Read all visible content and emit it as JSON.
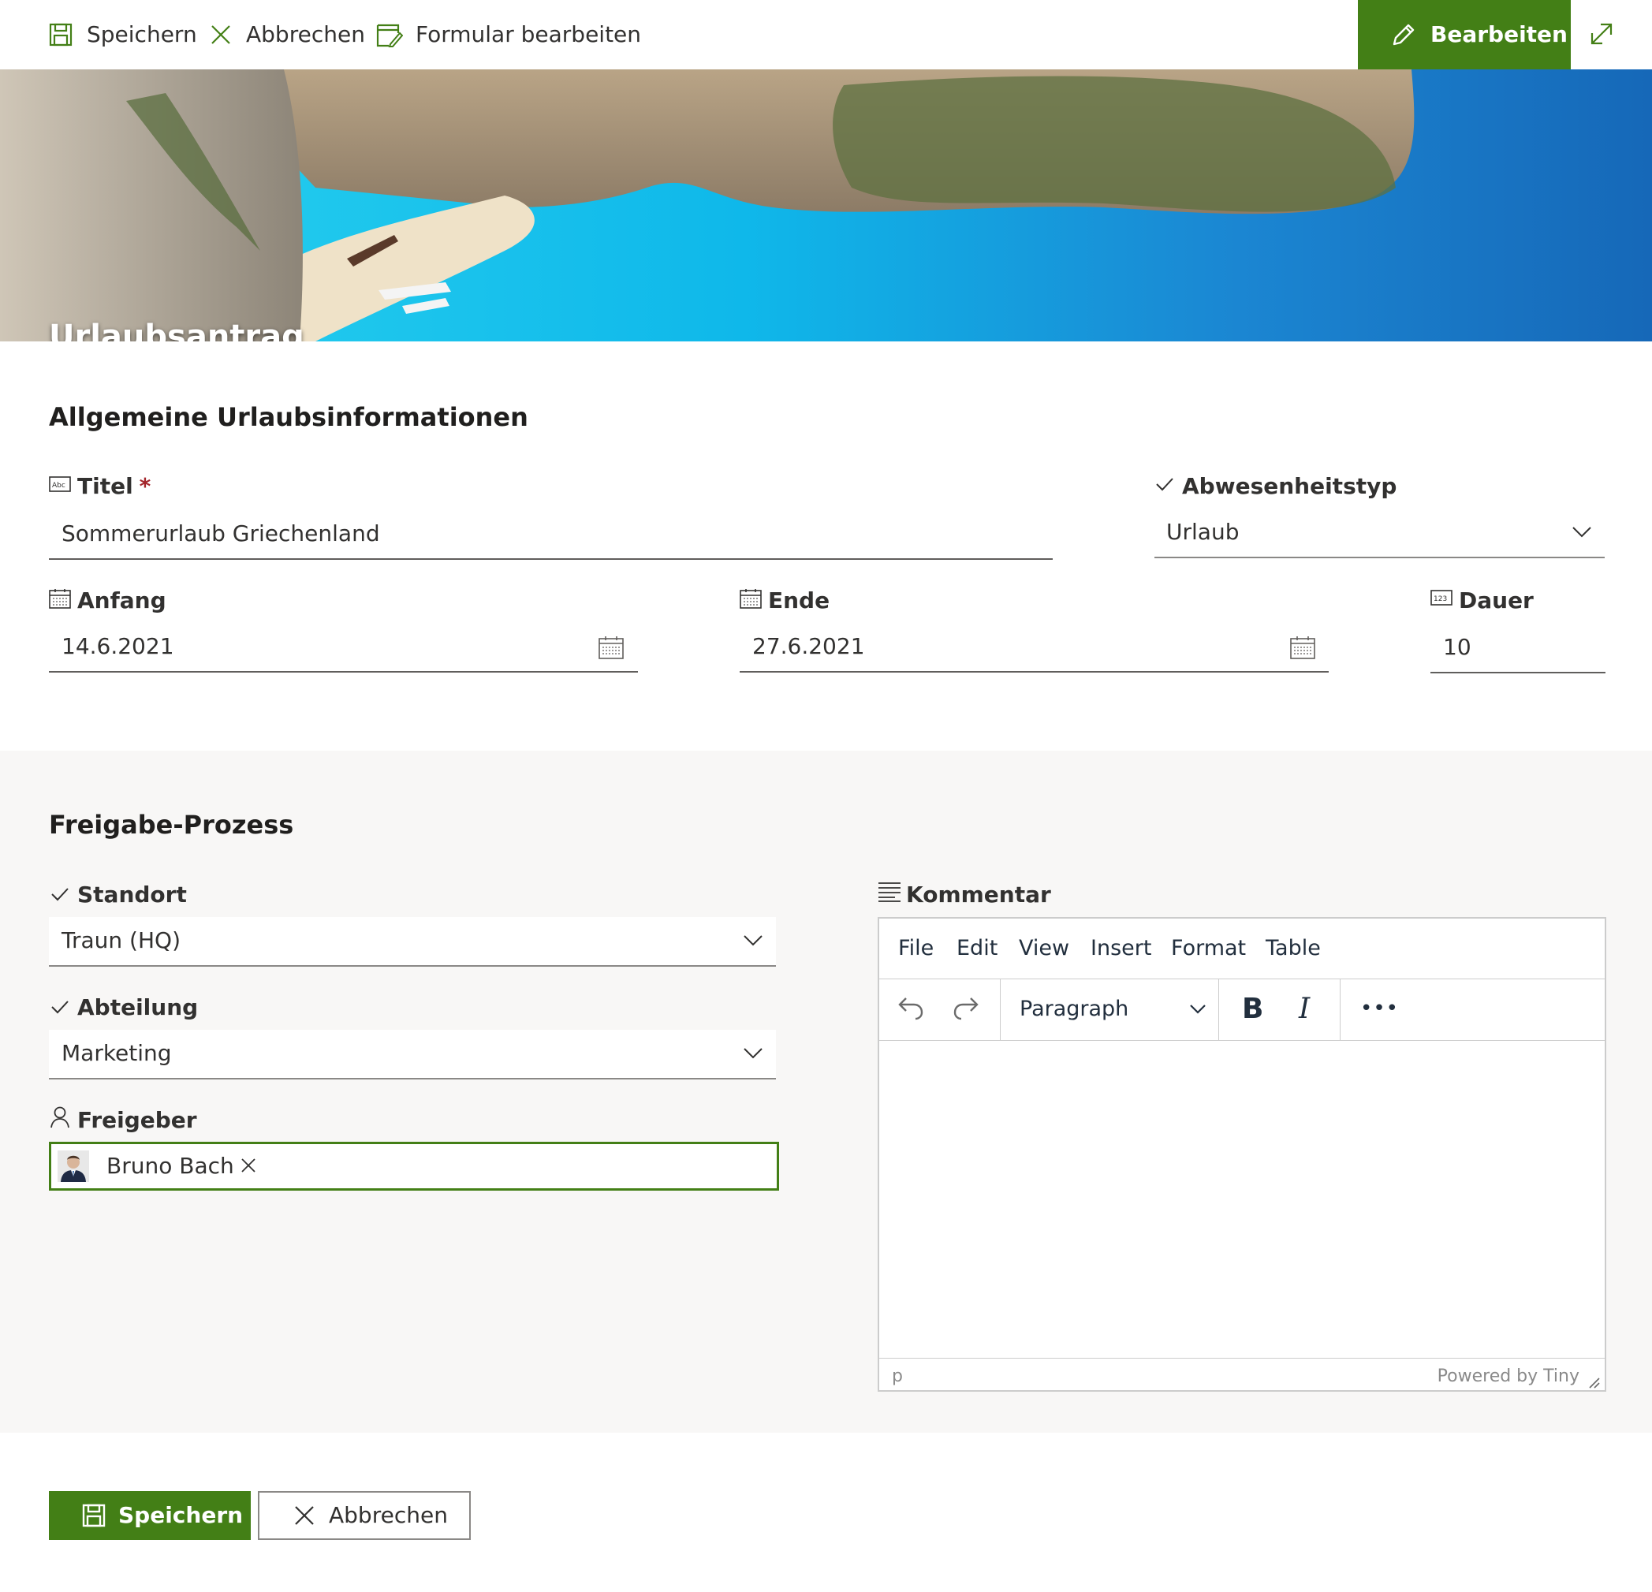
{
  "colors": {
    "accent": "#437f16",
    "text": "#323130",
    "required": "#a4262c",
    "section_bg": "#f8f7f6"
  },
  "toolbar": {
    "save_label": "Speichern",
    "cancel_label": "Abbrechen",
    "edit_form_label": "Formular bearbeiten",
    "edit_button_label": "Bearbeiten"
  },
  "banner": {
    "title": "Urlaubsantrag"
  },
  "general": {
    "heading": "Allgemeine Urlaubsinformationen",
    "title_field": {
      "label": "Titel",
      "required_mark": "*",
      "value": "Sommerurlaub Griechenland"
    },
    "absence_type": {
      "label": "Abwesenheitstyp",
      "value": "Urlaub"
    },
    "start": {
      "label": "Anfang",
      "value": "14.6.2021"
    },
    "end": {
      "label": "Ende",
      "value": "27.6.2021"
    },
    "duration": {
      "label": "Dauer",
      "value": "10"
    }
  },
  "approval": {
    "heading": "Freigabe-Prozess",
    "location": {
      "label": "Standort",
      "value": "Traun (HQ)"
    },
    "department": {
      "label": "Abteilung",
      "value": "Marketing"
    },
    "approver": {
      "label": "Freigeber",
      "person": "Bruno Bach"
    },
    "comment": {
      "label": "Kommentar",
      "menu": [
        "File",
        "Edit",
        "View",
        "Insert",
        "Format",
        "Table"
      ],
      "block_format": "Paragraph",
      "bold": "B",
      "italic": "I",
      "more": "•••",
      "status_path": "p",
      "powered_by": "Powered by Tiny"
    }
  },
  "footer": {
    "save_label": "Speichern",
    "cancel_label": "Abbrechen"
  }
}
